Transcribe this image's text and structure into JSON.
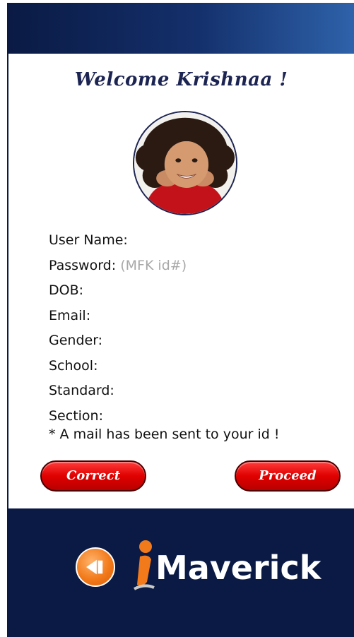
{
  "header": {
    "welcome_text": "Welcome Krishnaa !"
  },
  "profile": {
    "avatar_icon": "child-photo"
  },
  "form": {
    "fields": [
      {
        "label": "User Name:",
        "hint": ""
      },
      {
        "label": "Password:",
        "hint": "(MFK id#)"
      },
      {
        "label": "DOB:",
        "hint": ""
      },
      {
        "label": "Email:",
        "hint": ""
      },
      {
        "label": "Gender:",
        "hint": ""
      },
      {
        "label": "School:",
        "hint": ""
      },
      {
        "label": "Standard:",
        "hint": ""
      },
      {
        "label": "Section:",
        "hint": ""
      }
    ],
    "mail_note": "* A mail has been sent to your id !"
  },
  "actions": {
    "correct_label": "Correct",
    "proceed_label": "Proceed"
  },
  "footer": {
    "back_icon": "back-arrow-icon",
    "logo_text": "Maverick"
  },
  "colors": {
    "header_dark": "#0a1a44",
    "header_light": "#2e62aa",
    "button_red": "#e00000",
    "back_orange": "#f27a1a",
    "hint_gray": "#a8a8a8"
  }
}
